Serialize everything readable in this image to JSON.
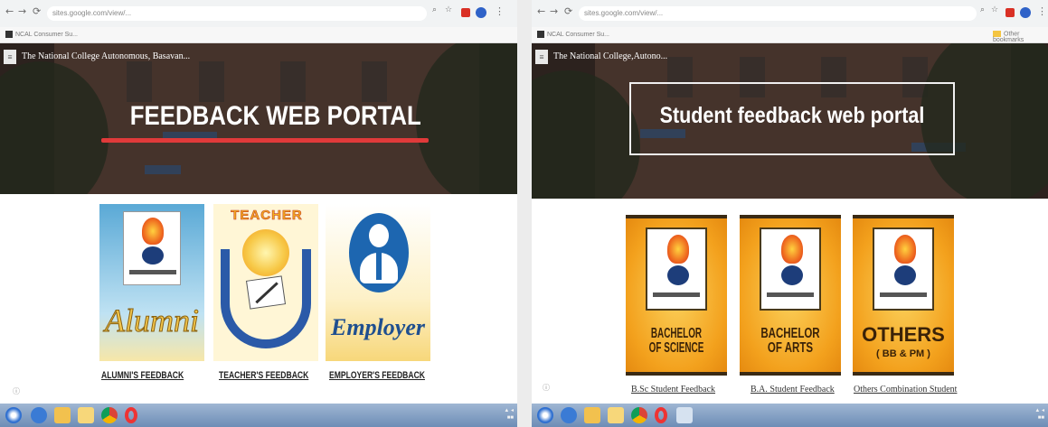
{
  "left": {
    "site_title": "The National College Autonomous, Basavan...",
    "hero_title": "FEEDBACK WEB PORTAL",
    "cards": [
      {
        "name": "alumni",
        "image_text": "Alumni",
        "label": "ALUMNI'S FEEDBACK"
      },
      {
        "name": "teacher",
        "image_text": "TEACHER",
        "label": "TEACHER'S FEEDBACK"
      },
      {
        "name": "employer",
        "image_text": "Employer",
        "label": "EMPLOYER'S FEEDBACK"
      }
    ]
  },
  "right": {
    "site_title": "The National College,Autono...",
    "hero_title": "Student feedback web portal",
    "cards": [
      {
        "name": "bsc",
        "image_text": "BACHELOR OF SCIENCE",
        "label": "B.Sc Student Feedback"
      },
      {
        "name": "ba",
        "image_text": "BACHELOR OF ARTS",
        "label": "B.A. Student Feedback"
      },
      {
        "name": "others",
        "image_text": "OTHERS",
        "image_subtext": "( BB & PM )",
        "label": "Others Combination Student"
      }
    ]
  },
  "browser": {
    "left_url": "sites.google.com/view/...",
    "right_url": "sites.google.com/view/...",
    "bookmark": "NCAL Consumer Su...",
    "other_bookmarks": "Other bookmarks"
  },
  "colors": {
    "red_accent": "#e03a3a",
    "hero_bg": "#3d2e29",
    "card_orange": "#f3a11d",
    "card_blue": "#5aa9d6"
  }
}
